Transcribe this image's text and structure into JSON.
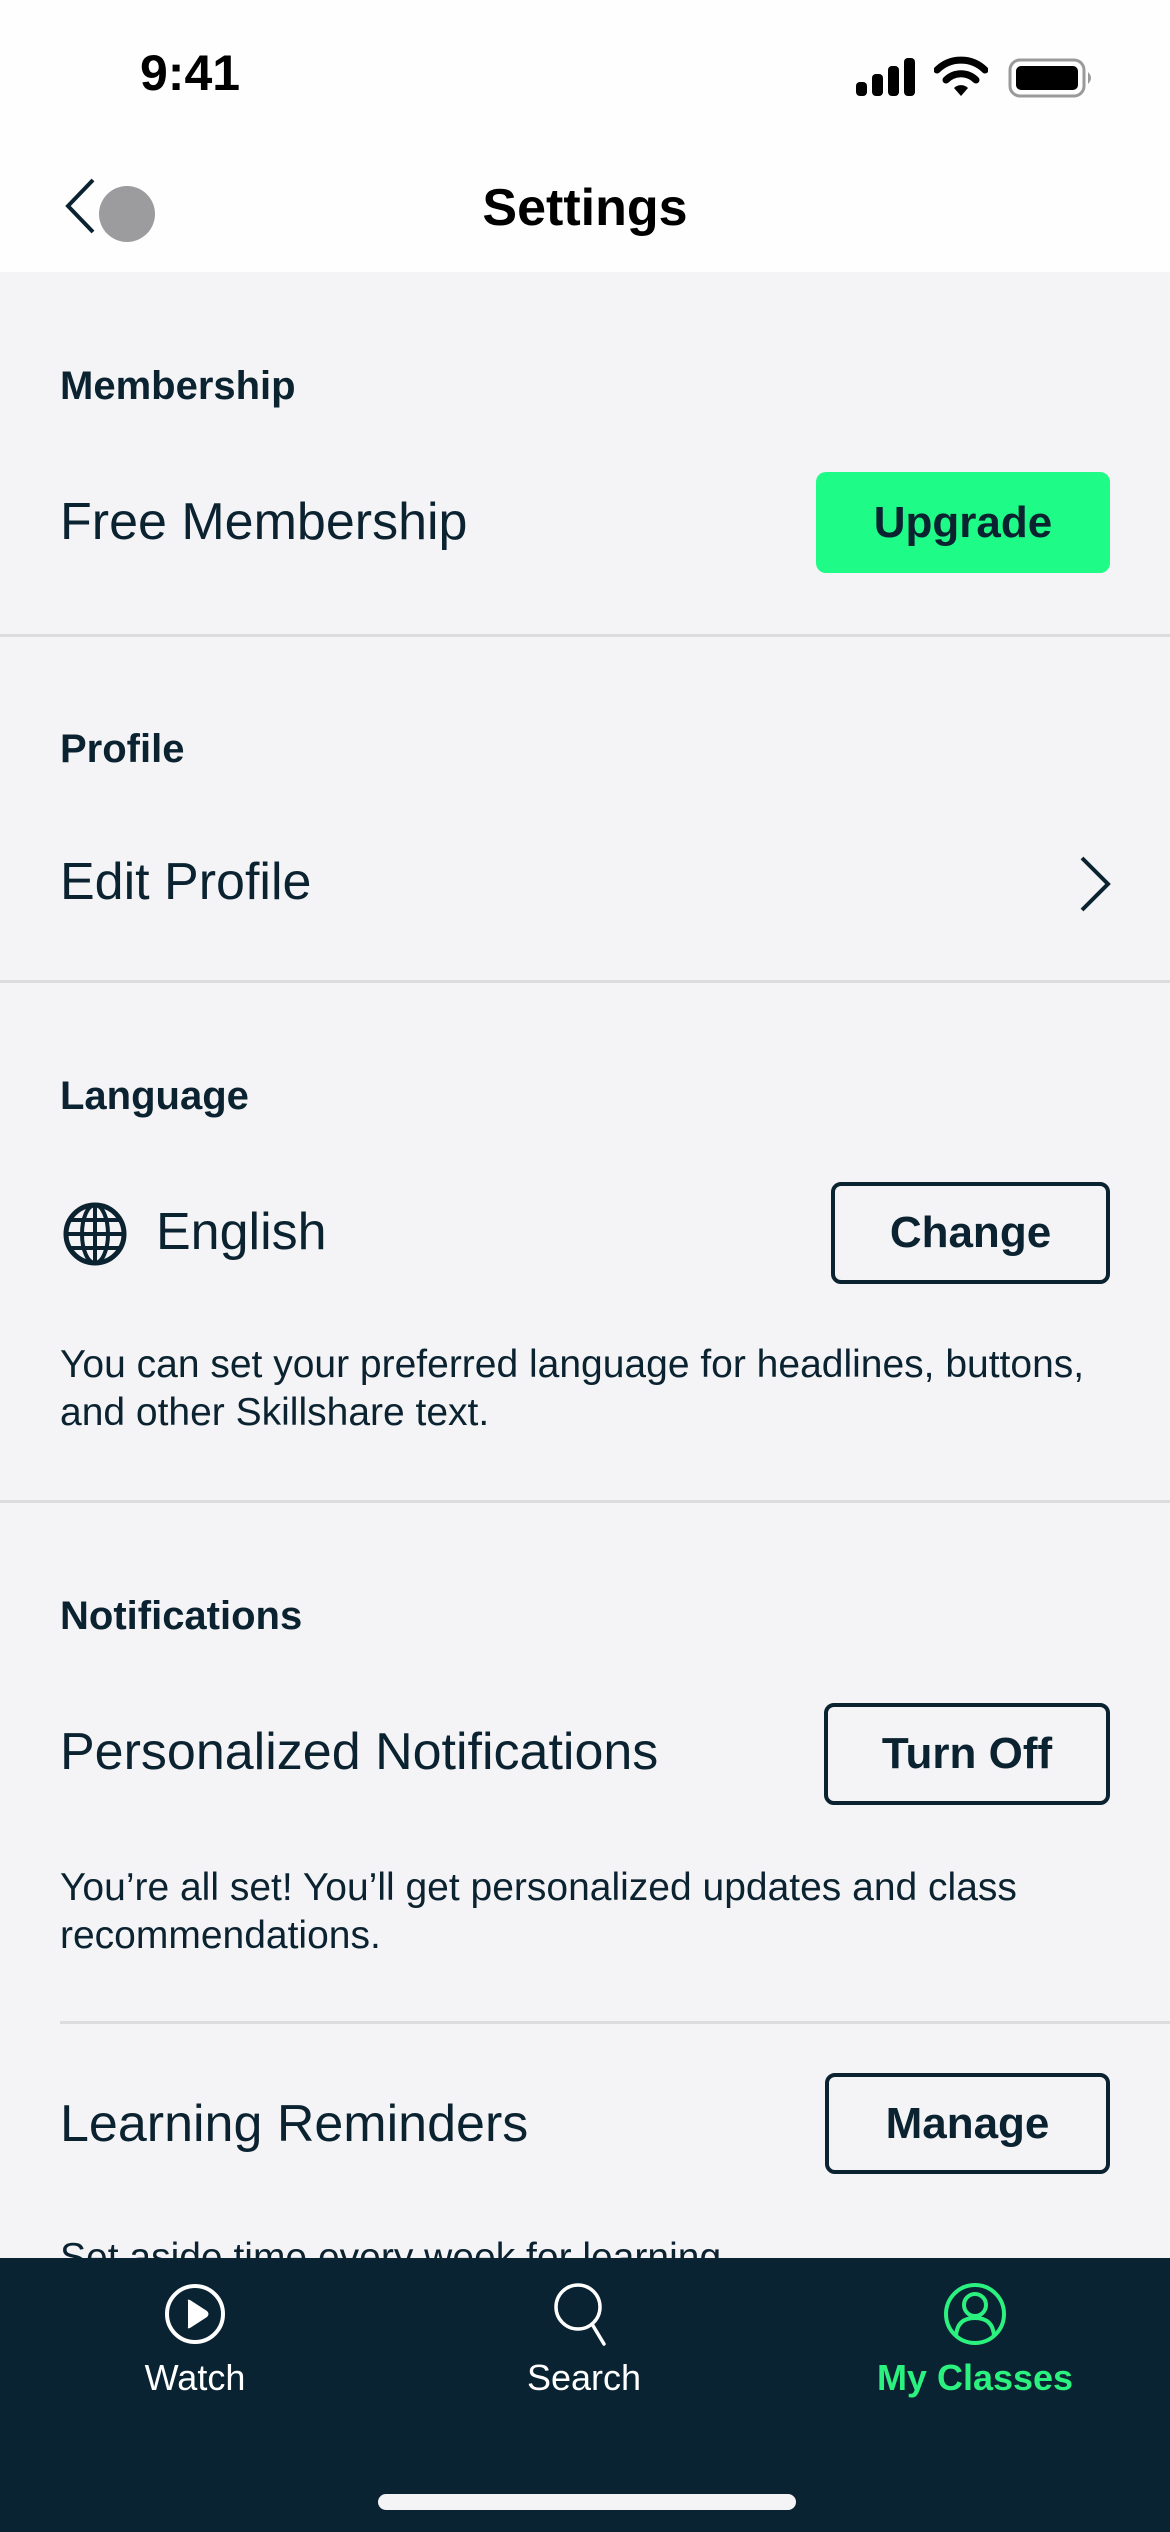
{
  "status_bar": {
    "time": "9:41",
    "icons": [
      "cellular-signal-icon",
      "wifi-icon",
      "battery-icon"
    ]
  },
  "nav": {
    "title": "Settings",
    "back_icon": "chevron-left-icon"
  },
  "colors": {
    "accent_green": "#1EFB86",
    "tab_active": "#2BF27F",
    "navy": "#0B2330",
    "tabbar_bg": "#0A2333",
    "page_bg": "#F4F3F6"
  },
  "sections": {
    "membership": {
      "heading": "Membership",
      "label": "Free Membership",
      "button": "Upgrade"
    },
    "profile": {
      "heading": "Profile",
      "label": "Edit Profile",
      "icon": "chevron-right-icon"
    },
    "language": {
      "heading": "Language",
      "icon": "globe-icon",
      "label": "English",
      "button": "Change",
      "description": "You can set your preferred language for headlines, buttons, and other Skillshare text."
    },
    "notifications": {
      "heading": "Notifications",
      "personalized": {
        "label": "Personalized Notifications",
        "button": "Turn Off",
        "description": "You’re all set! You’ll get personalized updates and class recommendations."
      },
      "reminders": {
        "label": "Learning Reminders",
        "button": "Manage",
        "description": "Set aside time every week for learning."
      }
    }
  },
  "tabbar": {
    "tabs": [
      {
        "label": "Watch",
        "icon": "play-circle-icon",
        "active": false
      },
      {
        "label": "Search",
        "icon": "search-icon",
        "active": false
      },
      {
        "label": "My Classes",
        "icon": "user-circle-icon",
        "active": true
      }
    ]
  }
}
